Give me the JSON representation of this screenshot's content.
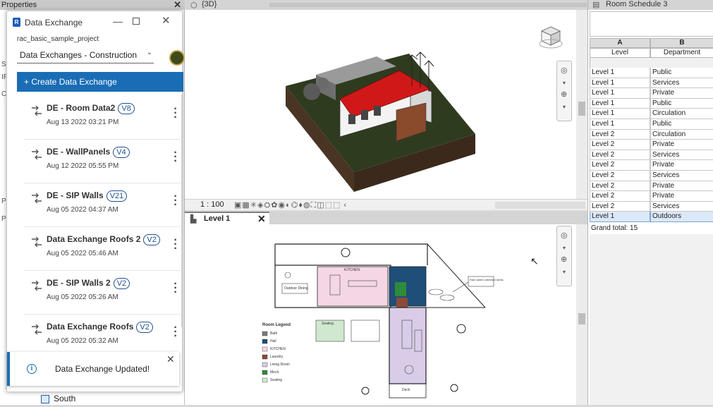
{
  "properties": {
    "title": "Properties",
    "close": "✕",
    "strip_letters": [
      "S",
      "IF",
      "C",
      "P",
      "P"
    ],
    "tree_item": "South"
  },
  "data_exchange": {
    "title": "Data Exchange",
    "logo": "R",
    "project": "rac_basic_sample_project",
    "dropdown_value": "Data Exchanges - Construction R",
    "create_button": "+ Create Data Exchange",
    "items": [
      {
        "name": "DE - Room Data2",
        "version": "V8",
        "date": "Aug 13 2022 03:21 PM"
      },
      {
        "name": "DE - WallPanels",
        "version": "V4",
        "date": "Aug 12 2022 05:55 PM"
      },
      {
        "name": "DE - SIP Walls",
        "version": "V21",
        "date": "Aug 05 2022 04:37 AM"
      },
      {
        "name": "Data Exchange Roofs 2",
        "version": "V2",
        "date": "Aug 05 2022 05:46 AM"
      },
      {
        "name": "DE - SIP Walls 2",
        "version": "V2",
        "date": "Aug 05 2022 05:26 AM"
      },
      {
        "name": "Data Exchange Roofs",
        "version": "V2",
        "date": "Aug 05 2022 05:32 AM"
      }
    ],
    "toast": {
      "icon": "i",
      "text": "Data Exchange Updated!",
      "close": "✕"
    },
    "accent_color": "#1a6db5"
  },
  "view3d": {
    "tab_label": "{3D}",
    "scale": "1 : 100"
  },
  "level1": {
    "tab_label": "Level 1",
    "close": "✕",
    "legend_title": "Room Legend",
    "legend_items": [
      {
        "label": "Bath",
        "color": "#7a7a7a"
      },
      {
        "label": "Hall",
        "color": "#1f4e79"
      },
      {
        "label": "KITCHEN",
        "color": "#f4d6e4"
      },
      {
        "label": "Laundry",
        "color": "#8b4a3a"
      },
      {
        "label": "Living Room",
        "color": "#d9cce8"
      },
      {
        "label": "Mech.",
        "color": "#2e8b3a"
      },
      {
        "label": "Seating",
        "color": "#cfe8cf"
      }
    ],
    "plan_labels": {
      "kitchen": "KITCHEN",
      "outdoor": "Outdoor Dining",
      "seating": "Seating",
      "deck": "Deck",
      "tanks": "Rain water collection tanks"
    }
  },
  "schedule": {
    "tab_label": "Room Schedule 3",
    "columns": [
      {
        "letter": "A",
        "field": "Level"
      },
      {
        "letter": "B",
        "field": "Department"
      }
    ],
    "rows": [
      [
        "Level 1",
        "Public"
      ],
      [
        "Level 1",
        "Services"
      ],
      [
        "Level 1",
        "Private"
      ],
      [
        "Level 1",
        "Public"
      ],
      [
        "Level 1",
        "Circulation"
      ],
      [
        "Level 1",
        "Public"
      ],
      [
        "Level 2",
        "Circulation"
      ],
      [
        "Level 2",
        "Private"
      ],
      [
        "Level 2",
        "Services"
      ],
      [
        "Level 2",
        "Private"
      ],
      [
        "Level 2",
        "Services"
      ],
      [
        "Level 2",
        "Private"
      ],
      [
        "Level 2",
        "Private"
      ],
      [
        "Level 2",
        "Services"
      ],
      [
        "Level 1",
        "Outdoors"
      ]
    ],
    "selected_row": 14,
    "grand_total": "Grand total: 15"
  }
}
